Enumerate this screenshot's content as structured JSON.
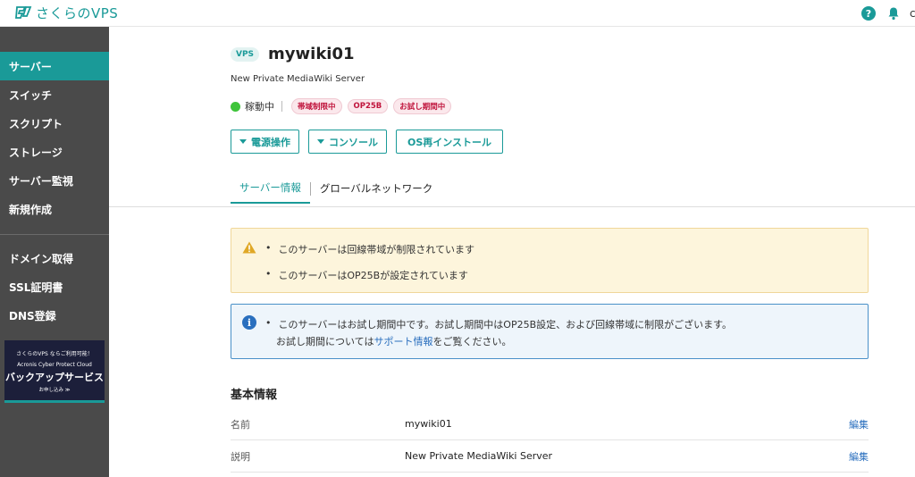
{
  "header": {
    "logo_text": "さくらのVPS",
    "help_glyph": "?",
    "user_initial": "c"
  },
  "sidebar": {
    "items": [
      {
        "label": "サーバー",
        "active": true
      },
      {
        "label": "スイッチ"
      },
      {
        "label": "スクリプト"
      },
      {
        "label": "ストレージ"
      },
      {
        "label": "サーバー監視"
      },
      {
        "label": "新規作成"
      }
    ],
    "items2": [
      {
        "label": "ドメイン取得"
      },
      {
        "label": "SSL証明書"
      },
      {
        "label": "DNS登録"
      }
    ],
    "banner": {
      "line1": "さくらのVPS ならご利用可能！",
      "line2": "Acronis Cyber Protect Cloud",
      "line3": "バックアップサービス",
      "line4": "お申し込み ≫"
    }
  },
  "server": {
    "badge": "VPS",
    "name": "mywiki01",
    "description": "New Private MediaWiki Server",
    "status": "稼動中",
    "tags": [
      "帯域制限中",
      "OP25B",
      "お試し期間中"
    ]
  },
  "actions": {
    "power": "電源操作",
    "console": "コンソール",
    "reinstall": "OS再インストール"
  },
  "tabs": [
    {
      "label": "サーバー情報",
      "active": true
    },
    {
      "label": "グローバルネットワーク"
    }
  ],
  "warning": {
    "messages": [
      "このサーバーは回線帯域が制限されています",
      "このサーバーはOP25Bが設定されています"
    ]
  },
  "info": {
    "line1": "このサーバーはお試し期間中です。お試し期間中はOP25B設定、および回線帯域に制限がございます。",
    "line2_prefix": "お試し期間については",
    "line2_link": "サポート情報",
    "line2_suffix": "をご覧ください。"
  },
  "basic_info": {
    "title": "基本情報",
    "rows": [
      {
        "key": "名前",
        "value": "mywiki01",
        "action": "編集"
      },
      {
        "key": "説明",
        "value": "New Private MediaWiki Server",
        "action": "編集"
      }
    ]
  },
  "colors": {
    "accent": "#1a9a98",
    "sidebar_bg": "#4a4a4a",
    "status_ok": "#3ec43a",
    "tag_red": "#c0143c",
    "link_blue": "#2a6fbe"
  }
}
